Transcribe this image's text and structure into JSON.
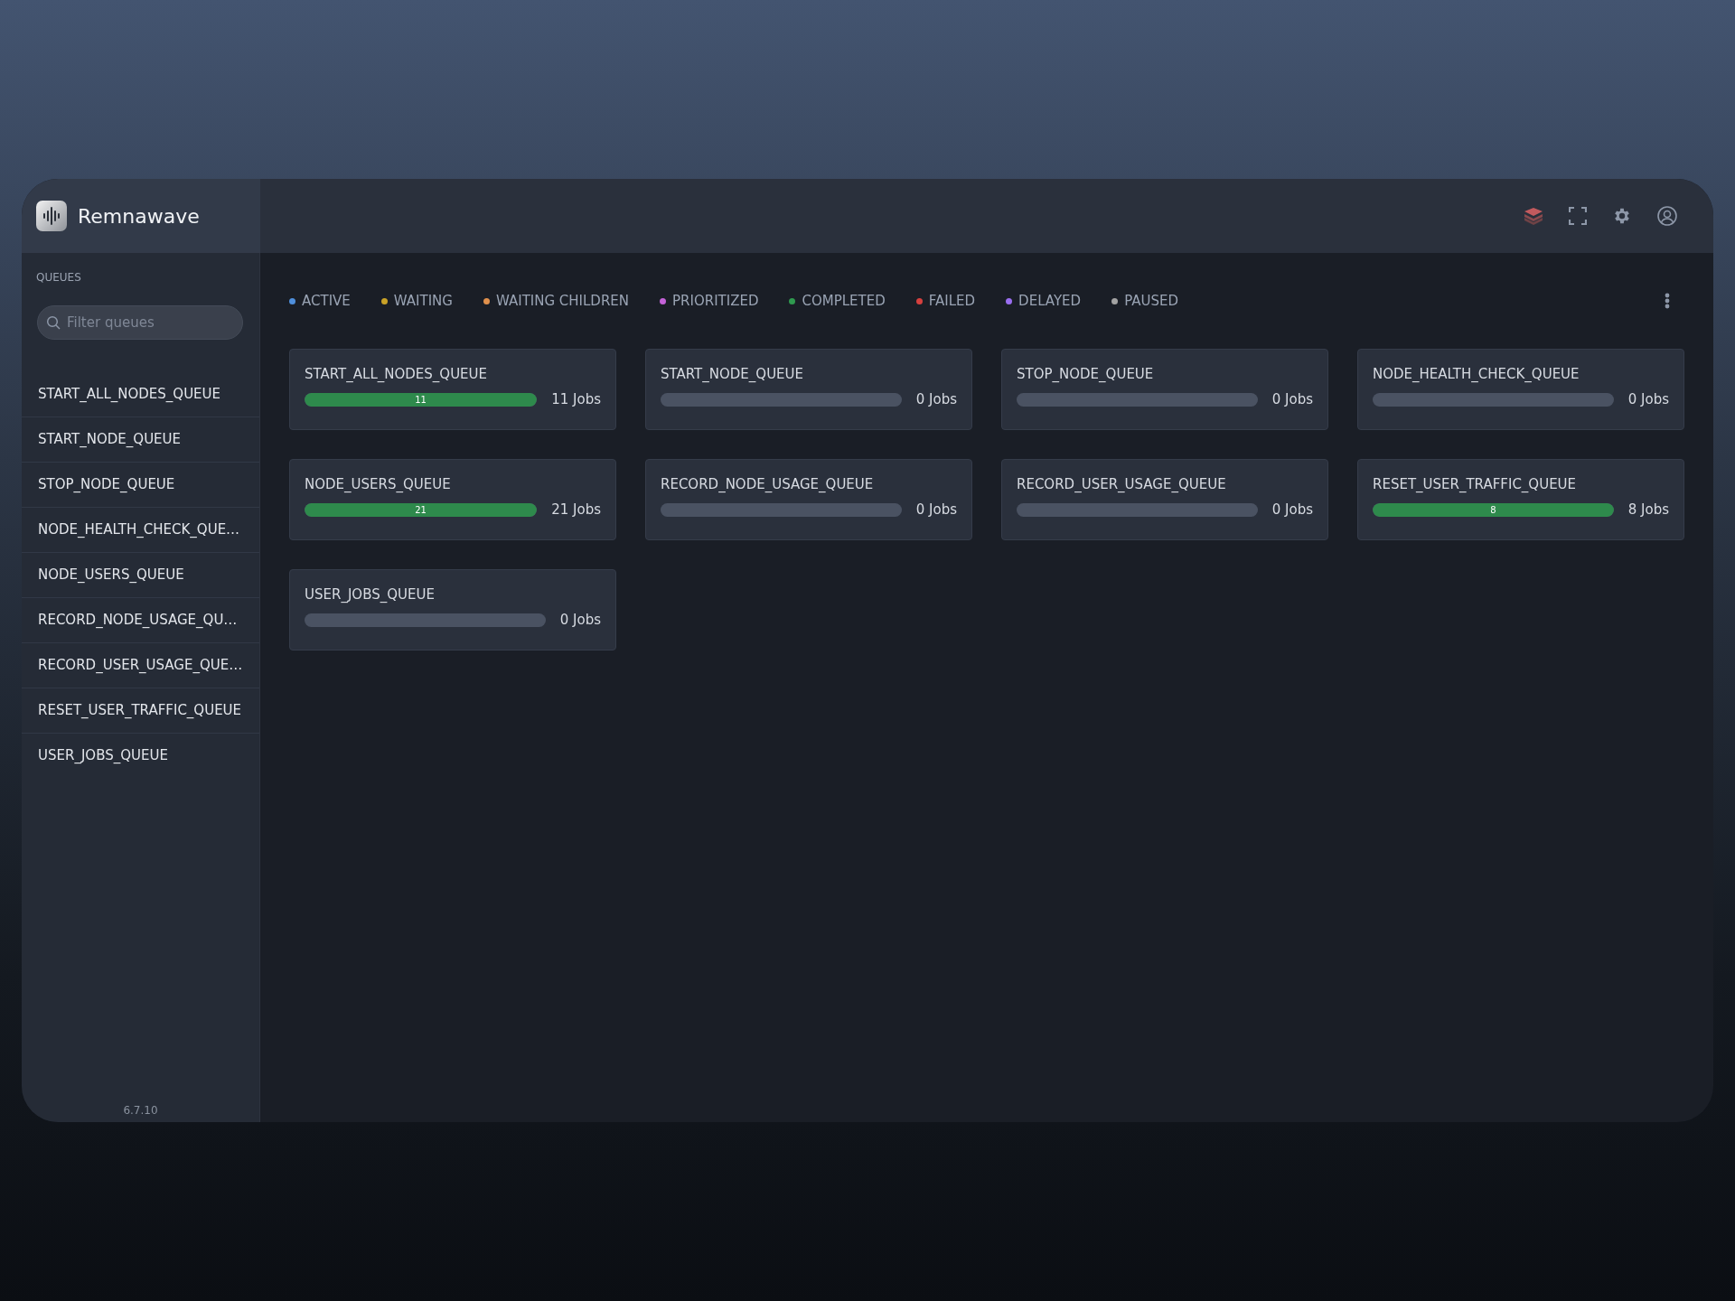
{
  "app": {
    "name": "Remnawave",
    "version": "6.7.10"
  },
  "sidebar": {
    "heading": "QUEUES",
    "search": {
      "placeholder": "Filter queues"
    },
    "items": [
      "START_ALL_NODES_QUEUE",
      "START_NODE_QUEUE",
      "STOP_NODE_QUEUE",
      "NODE_HEALTH_CHECK_QUE…",
      "NODE_USERS_QUEUE",
      "RECORD_NODE_USAGE_QU…",
      "RECORD_USER_USAGE_QUE…",
      "RESET_USER_TRAFFIC_QUEUE",
      "USER_JOBS_QUEUE"
    ]
  },
  "legend": [
    {
      "label": "ACTIVE",
      "color": "#4f8fdc"
    },
    {
      "label": "WAITING",
      "color": "#c9a227"
    },
    {
      "label": "WAITING CHILDREN",
      "color": "#e0904c"
    },
    {
      "label": "PRIORITIZED",
      "color": "#c462d8"
    },
    {
      "label": "COMPLETED",
      "color": "#2f9a4f"
    },
    {
      "label": "FAILED",
      "color": "#d6403e"
    },
    {
      "label": "DELAYED",
      "color": "#9a6ef0"
    },
    {
      "label": "PAUSED",
      "color": "#a3a3a3"
    }
  ],
  "queues": [
    {
      "name": "START_ALL_NODES_QUEUE",
      "bar_label": "11",
      "level": 1,
      "jobs": "11 Jobs"
    },
    {
      "name": "START_NODE_QUEUE",
      "level": 0,
      "jobs": "0 Jobs"
    },
    {
      "name": "STOP_NODE_QUEUE",
      "level": 0,
      "jobs": "0 Jobs"
    },
    {
      "name": "NODE_HEALTH_CHECK_QUEUE",
      "level": 0,
      "jobs": "0 Jobs"
    },
    {
      "name": "NODE_USERS_QUEUE",
      "bar_label": "21",
      "level": 1,
      "jobs": "21 Jobs"
    },
    {
      "name": "RECORD_NODE_USAGE_QUEUE",
      "level": 0,
      "jobs": "0 Jobs"
    },
    {
      "name": "RECORD_USER_USAGE_QUEUE",
      "level": 0,
      "jobs": "0 Jobs"
    },
    {
      "name": "RESET_USER_TRAFFIC_QUEUE",
      "bar_label": "8",
      "level": 1,
      "jobs": "8 Jobs"
    },
    {
      "name": "USER_JOBS_QUEUE",
      "level": 0,
      "jobs": "0 Jobs"
    }
  ]
}
